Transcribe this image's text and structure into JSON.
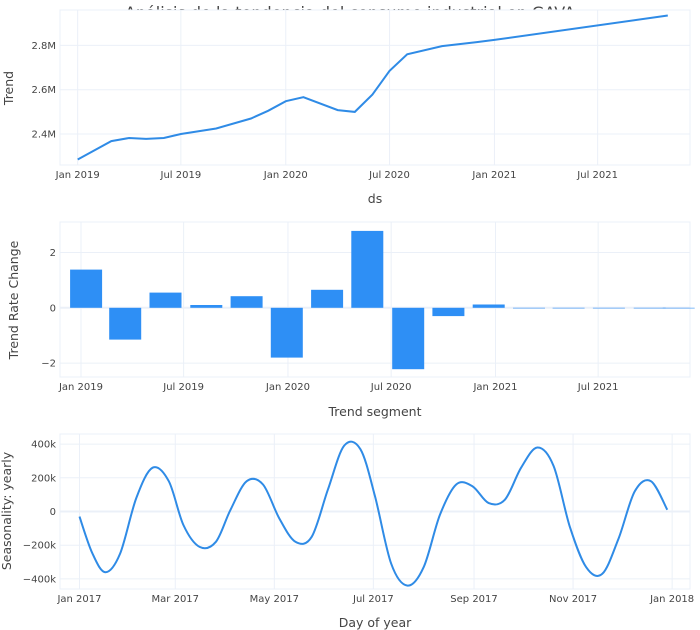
{
  "title": "Análisis de la tendencia del consumo industrial en GAVA",
  "colors": {
    "line": "#2f8be6",
    "bar": "#2e8ff5",
    "grid": "#ebf0f8",
    "text": "#444444"
  },
  "chart_data": [
    {
      "type": "line",
      "xlabel": "ds",
      "ylabel": "Trend",
      "x_ticks": [
        "Jan 2019",
        "Jul 2019",
        "Jan 2020",
        "Jul 2020",
        "Jan 2021",
        "Jul 2021"
      ],
      "y_ticks": [
        "2.4M",
        "2.6M",
        "2.8M"
      ],
      "y_tick_values": [
        2400000,
        2600000,
        2800000
      ],
      "x_range": [
        "2018-12-01",
        "2021-12-10"
      ],
      "ylim": [
        2260000,
        2960000
      ],
      "grid": true,
      "series": [
        {
          "x": [
            "2019-01-01",
            "2019-03-01",
            "2019-04-01",
            "2019-05-01",
            "2019-06-01",
            "2019-07-01",
            "2019-09-01",
            "2019-11-01",
            "2019-12-01",
            "2020-01-01",
            "2020-02-01",
            "2020-04-01",
            "2020-05-01",
            "2020-06-01",
            "2020-07-01",
            "2020-08-01",
            "2020-10-01",
            "2020-12-01",
            "2021-01-01",
            "2021-11-01"
          ],
          "y": [
            2285000,
            2368000,
            2382000,
            2378000,
            2382000,
            2400000,
            2425000,
            2470000,
            2505000,
            2548000,
            2566000,
            2508000,
            2500000,
            2578000,
            2685000,
            2760000,
            2797000,
            2815000,
            2825000,
            2935000
          ]
        }
      ]
    },
    {
      "type": "bar",
      "xlabel": "Trend segment",
      "ylabel": "Trend Rate Change",
      "x_ticks": [
        "Jan 2019",
        "Jul 2019",
        "Jan 2020",
        "Jul 2020",
        "Jan 2021",
        "Jul 2021"
      ],
      "y_ticks": [
        "−2",
        "0",
        "2"
      ],
      "y_tick_values": [
        -2,
        0,
        2
      ],
      "x_range": [
        "2018-11-25",
        "2021-12-10"
      ],
      "ylim": [
        -2.5,
        3.1
      ],
      "grid": true,
      "x": [
        "2019-01-10",
        "2019-03-20",
        "2019-05-30",
        "2019-08-10",
        "2019-10-20",
        "2019-12-30",
        "2020-03-10",
        "2020-05-20",
        "2020-07-31",
        "2020-10-10",
        "2020-12-20",
        "2021-03-01",
        "2021-05-10",
        "2021-07-20",
        "2021-09-30",
        "2021-11-20"
      ],
      "values": [
        1.38,
        -1.15,
        0.55,
        0.1,
        0.42,
        -1.8,
        0.65,
        2.78,
        -2.22,
        -0.3,
        0.12,
        0,
        0,
        0,
        0,
        0
      ]
    },
    {
      "type": "line",
      "xlabel": "Day of year",
      "ylabel": "Seasonality: yearly",
      "x_ticks": [
        "Jan 2017",
        "Mar 2017",
        "May 2017",
        "Jul 2017",
        "Sep 2017",
        "Nov 2017",
        "Jan 2018"
      ],
      "y_ticks": [
        "−400k",
        "−200k",
        "0",
        "200k",
        "400k"
      ],
      "y_tick_values": [
        -400000,
        -200000,
        0,
        200000,
        400000
      ],
      "x_range": [
        "2016-12-20",
        "2018-01-12"
      ],
      "ylim": [
        -460000,
        460000
      ],
      "grid": true,
      "series": [
        {
          "x": [
            "2017-01-01",
            "2017-01-09",
            "2017-01-17",
            "2017-01-26",
            "2017-02-05",
            "2017-02-15",
            "2017-02-25",
            "2017-03-06",
            "2017-03-16",
            "2017-03-26",
            "2017-04-04",
            "2017-04-14",
            "2017-04-24",
            "2017-05-04",
            "2017-05-14",
            "2017-05-24",
            "2017-06-03",
            "2017-06-13",
            "2017-06-23",
            "2017-07-02",
            "2017-07-12",
            "2017-07-22",
            "2017-08-01",
            "2017-08-11",
            "2017-08-21",
            "2017-08-31",
            "2017-09-10",
            "2017-09-20",
            "2017-09-30",
            "2017-10-10",
            "2017-10-20",
            "2017-10-30",
            "2017-11-09",
            "2017-11-19",
            "2017-11-29",
            "2017-12-09",
            "2017-12-19",
            "2017-12-29"
          ],
          "y": [
            -30000,
            -250000,
            -360000,
            -250000,
            80000,
            260000,
            180000,
            -80000,
            -210000,
            -180000,
            10000,
            180000,
            160000,
            -40000,
            -180000,
            -150000,
            130000,
            390000,
            370000,
            90000,
            -310000,
            -440000,
            -330000,
            -20000,
            160000,
            150000,
            50000,
            70000,
            260000,
            380000,
            270000,
            -90000,
            -330000,
            -370000,
            -160000,
            120000,
            180000,
            10000
          ]
        }
      ]
    }
  ]
}
